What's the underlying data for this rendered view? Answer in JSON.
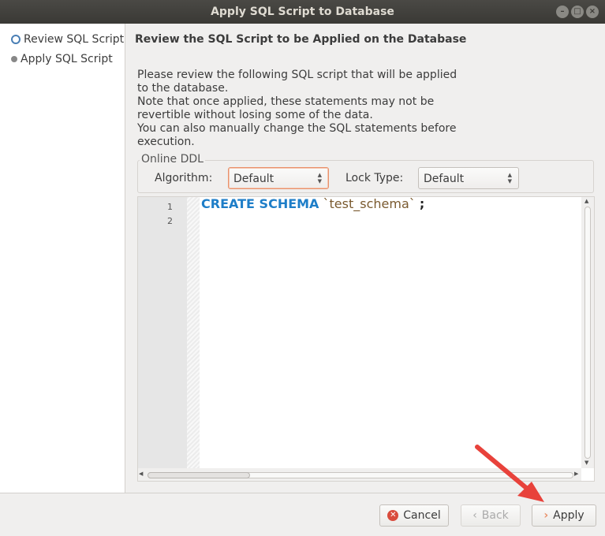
{
  "window": {
    "title": "Apply SQL Script to Database"
  },
  "sidebar": {
    "steps": [
      {
        "label": "Review SQL Script",
        "active": true
      },
      {
        "label": "Apply SQL Script",
        "active": false
      }
    ]
  },
  "main": {
    "heading": "Review the SQL Script to be Applied on the Database",
    "description": [
      "Please review the following SQL script that will be applied",
      "to the database.",
      "Note that once applied, these statements may not be",
      "revertible without losing some of the data.",
      "You can also manually change the SQL statements before",
      "execution."
    ],
    "online_ddl": {
      "group_label": "Online DDL",
      "algorithm_label": "Algorithm:",
      "algorithm_value": "Default",
      "lock_type_label": "Lock Type:",
      "lock_type_value": "Default"
    },
    "editor": {
      "line_numbers": [
        "1",
        "2"
      ],
      "code": {
        "keyword": "CREATE SCHEMA",
        "identifier": "`test_schema`",
        "terminator": ";"
      }
    }
  },
  "footer": {
    "cancel_label": "Cancel",
    "back_label": "Back",
    "apply_label": "Apply"
  },
  "colors": {
    "accent": "#e9916b",
    "keyword": "#1e7ec8",
    "annotation_arrow": "#e8423b"
  },
  "icons": [
    "cancel-icon",
    "back-chevron-icon",
    "apply-chevron-icon",
    "step-radio-icon"
  ]
}
